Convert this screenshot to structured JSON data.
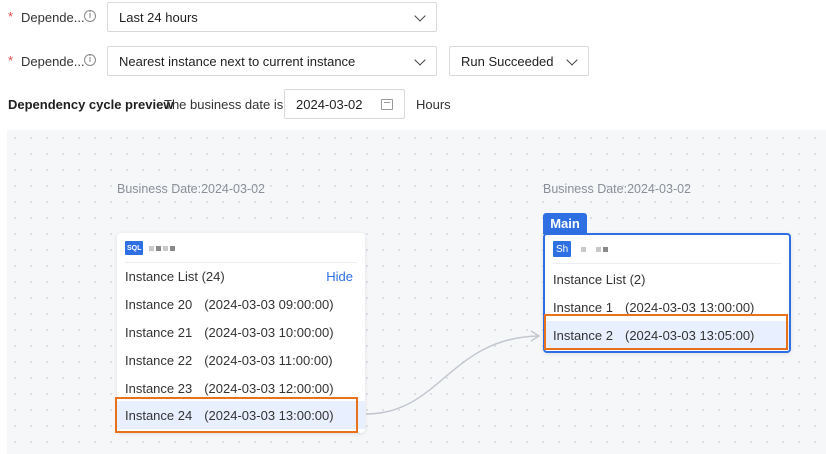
{
  "form": {
    "row1": {
      "required": "*",
      "label": "Depende...",
      "info": "i",
      "value": "Last 24 hours"
    },
    "row2": {
      "required": "*",
      "label": "Depende...",
      "info": "i",
      "value": "Nearest instance next to current instance",
      "status_value": "Run Succeeded"
    }
  },
  "preview": {
    "title": "Dependency cycle preview",
    "business_date_text": "The business date is",
    "business_date": "2024-03-02",
    "hours": "Hours"
  },
  "graph": {
    "upstream": {
      "business_date_label": "Business Date:2024-03-02",
      "type_badge": "SQL",
      "list_title": "Instance List (24)",
      "hide_label": "Hide",
      "instances": [
        {
          "name": "Instance 20",
          "time": "(2024-03-03 09:00:00)"
        },
        {
          "name": "Instance 21",
          "time": "(2024-03-03 10:00:00)"
        },
        {
          "name": "Instance 22",
          "time": "(2024-03-03 11:00:00)"
        },
        {
          "name": "Instance 23",
          "time": "(2024-03-03 12:00:00)"
        },
        {
          "name": "Instance 24",
          "time": "(2024-03-03 13:00:00)"
        }
      ]
    },
    "main": {
      "tag": "Main",
      "business_date_label": "Business Date:2024-03-02",
      "type_badge": "Sh",
      "list_title": "Instance List (2)",
      "instances": [
        {
          "name": "Instance 1",
          "time": "(2024-03-03 13:00:00)"
        },
        {
          "name": "Instance 2",
          "time": "(2024-03-03 13:05:00)"
        }
      ]
    }
  },
  "colors": {
    "accent": "#2f6fe4",
    "highlight": "#e8711c",
    "required": "#e5484d"
  }
}
